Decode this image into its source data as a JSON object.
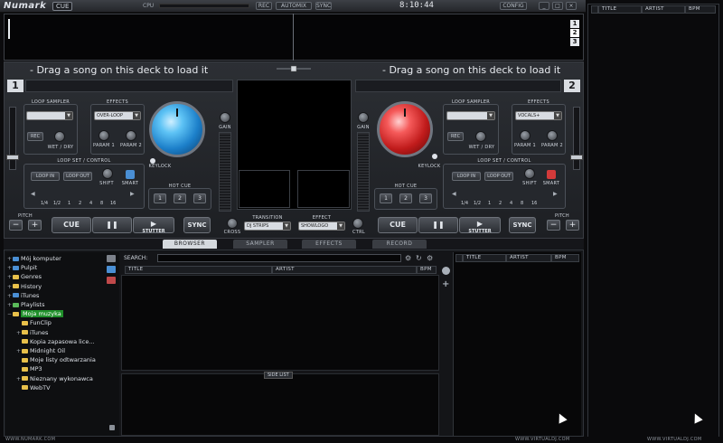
{
  "top_bar": {
    "logo_text": "Numark",
    "logo_badge": "CUE",
    "cpu_label": "CPU",
    "buttons": [
      "REC",
      "AUTOMIX",
      "SYNC"
    ],
    "clock": "8:10:44",
    "config_label": "CONFIG"
  },
  "waveform": {
    "deck_buttons": [
      "1",
      "2",
      "3"
    ]
  },
  "deck_left": {
    "number": "1",
    "drag_text": "- Drag a song on this deck to load it",
    "loop_sampler_label": "LOOP SAMPLER",
    "effects_label": "EFFECTS",
    "effect_selected": "OVER-LOOP",
    "rec_label": "REC",
    "wet_dry_label": "WET / DRY",
    "param1_label": "PARAM 1",
    "param2_label": "PARAM 2",
    "keylock_label": "KEYLOCK",
    "gain_label": "GAIN",
    "loop_set_label": "LOOP SET / CONTROL",
    "loop_in_label": "LOOP IN",
    "loop_out_label": "LOOP OUT",
    "shift_label": "SHIFT",
    "smart_label": "SMART",
    "loop_sizes": [
      "1/4",
      "1/2",
      "1",
      "2",
      "4",
      "8",
      "16"
    ],
    "hot_cue_label": "HOT CUE",
    "hot_cues": [
      "1",
      "2",
      "3"
    ],
    "pitch_label": "PITCH",
    "minus_label": "−",
    "plus_label": "+",
    "cue_label": "CUE",
    "play_label": "❚❚",
    "stutter_label": "STUTTER",
    "sync_label": "SYNC"
  },
  "deck_right": {
    "number": "2",
    "drag_text": "- Drag a song on this deck to load it",
    "loop_sampler_label": "LOOP SAMPLER",
    "effects_label": "EFFECTS",
    "effect_selected": "VOCALS+",
    "rec_label": "REC",
    "wet_dry_label": "WET / DRY",
    "param1_label": "PARAM 1",
    "param2_label": "PARAM 2",
    "keylock_label": "KEYLOCK",
    "gain_label": "GAIN",
    "loop_set_label": "LOOP SET / CONTROL",
    "loop_in_label": "LOOP IN",
    "loop_out_label": "LOOP OUT",
    "shift_label": "SHIFT",
    "smart_label": "SMART",
    "loop_sizes": [
      "1/4",
      "1/2",
      "1",
      "2",
      "4",
      "8",
      "16"
    ],
    "hot_cue_label": "HOT CUE",
    "hot_cues": [
      "1",
      "2",
      "3"
    ],
    "pitch_label": "PITCH",
    "minus_label": "−",
    "plus_label": "+",
    "cue_label": "CUE",
    "play_label": "❚❚",
    "stutter_label": "STUTTER",
    "sync_label": "SYNC"
  },
  "mixer": {
    "cross_label": "CROSS",
    "transition_label": "TRANSITION",
    "transition_value": "DJ STRIPS",
    "effect_label": "EFFECT",
    "effect_value": "SHOWLOGO",
    "ctrl_label": "CTRL"
  },
  "tabs": [
    "BROWSER",
    "SAMPLER",
    "EFFECTS",
    "RECORD"
  ],
  "browser": {
    "tree": [
      {
        "label": "Mój komputer",
        "exp": "+",
        "icon": "computer-icon",
        "indent": 0
      },
      {
        "label": "Pulpit",
        "exp": "+",
        "icon": "desktop-icon",
        "indent": 0
      },
      {
        "label": "Genres",
        "exp": "+",
        "icon": "genres-icon",
        "indent": 0
      },
      {
        "label": "History",
        "exp": "+",
        "icon": "history-icon",
        "indent": 0
      },
      {
        "label": "iTunes",
        "exp": "+",
        "icon": "itunes-icon",
        "indent": 0
      },
      {
        "label": "Playlists",
        "exp": "+",
        "icon": "playlists-icon",
        "indent": 0
      },
      {
        "label": "Moja muzyka",
        "exp": "−",
        "icon": "folder-icon",
        "indent": 0
      },
      {
        "label": "FunClip",
        "exp": "",
        "icon": "folder-icon",
        "indent": 1
      },
      {
        "label": "iTunes",
        "exp": "+",
        "icon": "folder-icon",
        "indent": 1
      },
      {
        "label": "Kopia zapasowa lice...",
        "exp": "",
        "icon": "folder-icon",
        "indent": 1
      },
      {
        "label": "Midnight Oil",
        "exp": "+",
        "icon": "folder-icon",
        "indent": 1
      },
      {
        "label": "Moje listy odtwarzania",
        "exp": "",
        "icon": "folder-icon",
        "indent": 1
      },
      {
        "label": "MP3",
        "exp": "",
        "icon": "folder-icon",
        "indent": 1
      },
      {
        "label": "Nieznany wykonawca",
        "exp": "+",
        "icon": "folder-icon",
        "indent": 1
      },
      {
        "label": "WebTV",
        "exp": "",
        "icon": "folder-icon",
        "indent": 1
      }
    ],
    "search_label": "SEARCH:",
    "columns": [
      "TITLE",
      "ARTIST",
      "BPM"
    ],
    "side_list_label": "SIDE LIST"
  },
  "right_list": {
    "columns": [
      "TITLE",
      "ARTIST",
      "BPM"
    ]
  },
  "far_panel": {
    "columns": [
      "TITLE",
      "ARTIST",
      "BPM"
    ]
  },
  "footer": {
    "left": "WWW.NUMARK.COM",
    "mid": "WWW.VIRTUALDJ.COM",
    "right": "WWW.VIRTUALDJ.COM"
  }
}
